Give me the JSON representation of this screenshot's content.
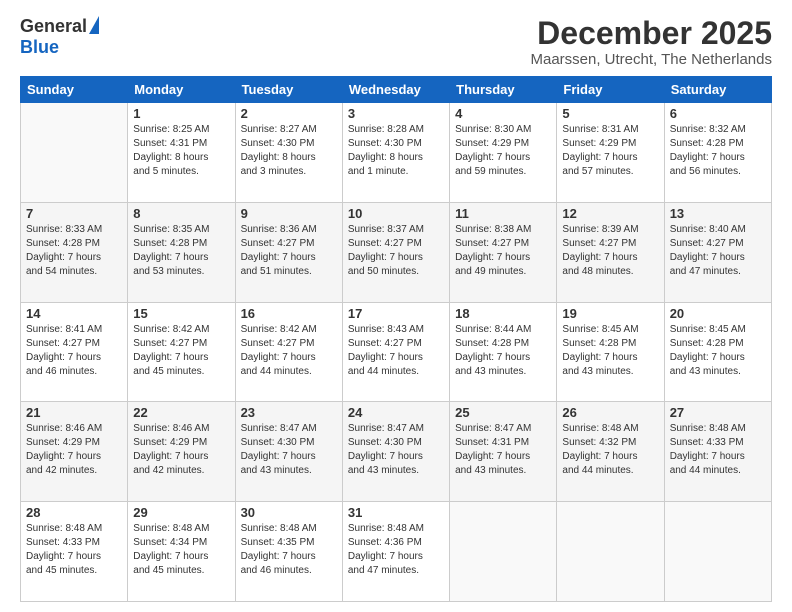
{
  "logo": {
    "general": "General",
    "blue": "Blue"
  },
  "header": {
    "month": "December 2025",
    "location": "Maarssen, Utrecht, The Netherlands"
  },
  "weekdays": [
    "Sunday",
    "Monday",
    "Tuesday",
    "Wednesday",
    "Thursday",
    "Friday",
    "Saturday"
  ],
  "weeks": [
    [
      {
        "day": "",
        "info": ""
      },
      {
        "day": "1",
        "info": "Sunrise: 8:25 AM\nSunset: 4:31 PM\nDaylight: 8 hours\nand 5 minutes."
      },
      {
        "day": "2",
        "info": "Sunrise: 8:27 AM\nSunset: 4:30 PM\nDaylight: 8 hours\nand 3 minutes."
      },
      {
        "day": "3",
        "info": "Sunrise: 8:28 AM\nSunset: 4:30 PM\nDaylight: 8 hours\nand 1 minute."
      },
      {
        "day": "4",
        "info": "Sunrise: 8:30 AM\nSunset: 4:29 PM\nDaylight: 7 hours\nand 59 minutes."
      },
      {
        "day": "5",
        "info": "Sunrise: 8:31 AM\nSunset: 4:29 PM\nDaylight: 7 hours\nand 57 minutes."
      },
      {
        "day": "6",
        "info": "Sunrise: 8:32 AM\nSunset: 4:28 PM\nDaylight: 7 hours\nand 56 minutes."
      }
    ],
    [
      {
        "day": "7",
        "info": "Sunrise: 8:33 AM\nSunset: 4:28 PM\nDaylight: 7 hours\nand 54 minutes."
      },
      {
        "day": "8",
        "info": "Sunrise: 8:35 AM\nSunset: 4:28 PM\nDaylight: 7 hours\nand 53 minutes."
      },
      {
        "day": "9",
        "info": "Sunrise: 8:36 AM\nSunset: 4:27 PM\nDaylight: 7 hours\nand 51 minutes."
      },
      {
        "day": "10",
        "info": "Sunrise: 8:37 AM\nSunset: 4:27 PM\nDaylight: 7 hours\nand 50 minutes."
      },
      {
        "day": "11",
        "info": "Sunrise: 8:38 AM\nSunset: 4:27 PM\nDaylight: 7 hours\nand 49 minutes."
      },
      {
        "day": "12",
        "info": "Sunrise: 8:39 AM\nSunset: 4:27 PM\nDaylight: 7 hours\nand 48 minutes."
      },
      {
        "day": "13",
        "info": "Sunrise: 8:40 AM\nSunset: 4:27 PM\nDaylight: 7 hours\nand 47 minutes."
      }
    ],
    [
      {
        "day": "14",
        "info": "Sunrise: 8:41 AM\nSunset: 4:27 PM\nDaylight: 7 hours\nand 46 minutes."
      },
      {
        "day": "15",
        "info": "Sunrise: 8:42 AM\nSunset: 4:27 PM\nDaylight: 7 hours\nand 45 minutes."
      },
      {
        "day": "16",
        "info": "Sunrise: 8:42 AM\nSunset: 4:27 PM\nDaylight: 7 hours\nand 44 minutes."
      },
      {
        "day": "17",
        "info": "Sunrise: 8:43 AM\nSunset: 4:27 PM\nDaylight: 7 hours\nand 44 minutes."
      },
      {
        "day": "18",
        "info": "Sunrise: 8:44 AM\nSunset: 4:28 PM\nDaylight: 7 hours\nand 43 minutes."
      },
      {
        "day": "19",
        "info": "Sunrise: 8:45 AM\nSunset: 4:28 PM\nDaylight: 7 hours\nand 43 minutes."
      },
      {
        "day": "20",
        "info": "Sunrise: 8:45 AM\nSunset: 4:28 PM\nDaylight: 7 hours\nand 43 minutes."
      }
    ],
    [
      {
        "day": "21",
        "info": "Sunrise: 8:46 AM\nSunset: 4:29 PM\nDaylight: 7 hours\nand 42 minutes."
      },
      {
        "day": "22",
        "info": "Sunrise: 8:46 AM\nSunset: 4:29 PM\nDaylight: 7 hours\nand 42 minutes."
      },
      {
        "day": "23",
        "info": "Sunrise: 8:47 AM\nSunset: 4:30 PM\nDaylight: 7 hours\nand 43 minutes."
      },
      {
        "day": "24",
        "info": "Sunrise: 8:47 AM\nSunset: 4:30 PM\nDaylight: 7 hours\nand 43 minutes."
      },
      {
        "day": "25",
        "info": "Sunrise: 8:47 AM\nSunset: 4:31 PM\nDaylight: 7 hours\nand 43 minutes."
      },
      {
        "day": "26",
        "info": "Sunrise: 8:48 AM\nSunset: 4:32 PM\nDaylight: 7 hours\nand 44 minutes."
      },
      {
        "day": "27",
        "info": "Sunrise: 8:48 AM\nSunset: 4:33 PM\nDaylight: 7 hours\nand 44 minutes."
      }
    ],
    [
      {
        "day": "28",
        "info": "Sunrise: 8:48 AM\nSunset: 4:33 PM\nDaylight: 7 hours\nand 45 minutes."
      },
      {
        "day": "29",
        "info": "Sunrise: 8:48 AM\nSunset: 4:34 PM\nDaylight: 7 hours\nand 45 minutes."
      },
      {
        "day": "30",
        "info": "Sunrise: 8:48 AM\nSunset: 4:35 PM\nDaylight: 7 hours\nand 46 minutes."
      },
      {
        "day": "31",
        "info": "Sunrise: 8:48 AM\nSunset: 4:36 PM\nDaylight: 7 hours\nand 47 minutes."
      },
      {
        "day": "",
        "info": ""
      },
      {
        "day": "",
        "info": ""
      },
      {
        "day": "",
        "info": ""
      }
    ]
  ]
}
